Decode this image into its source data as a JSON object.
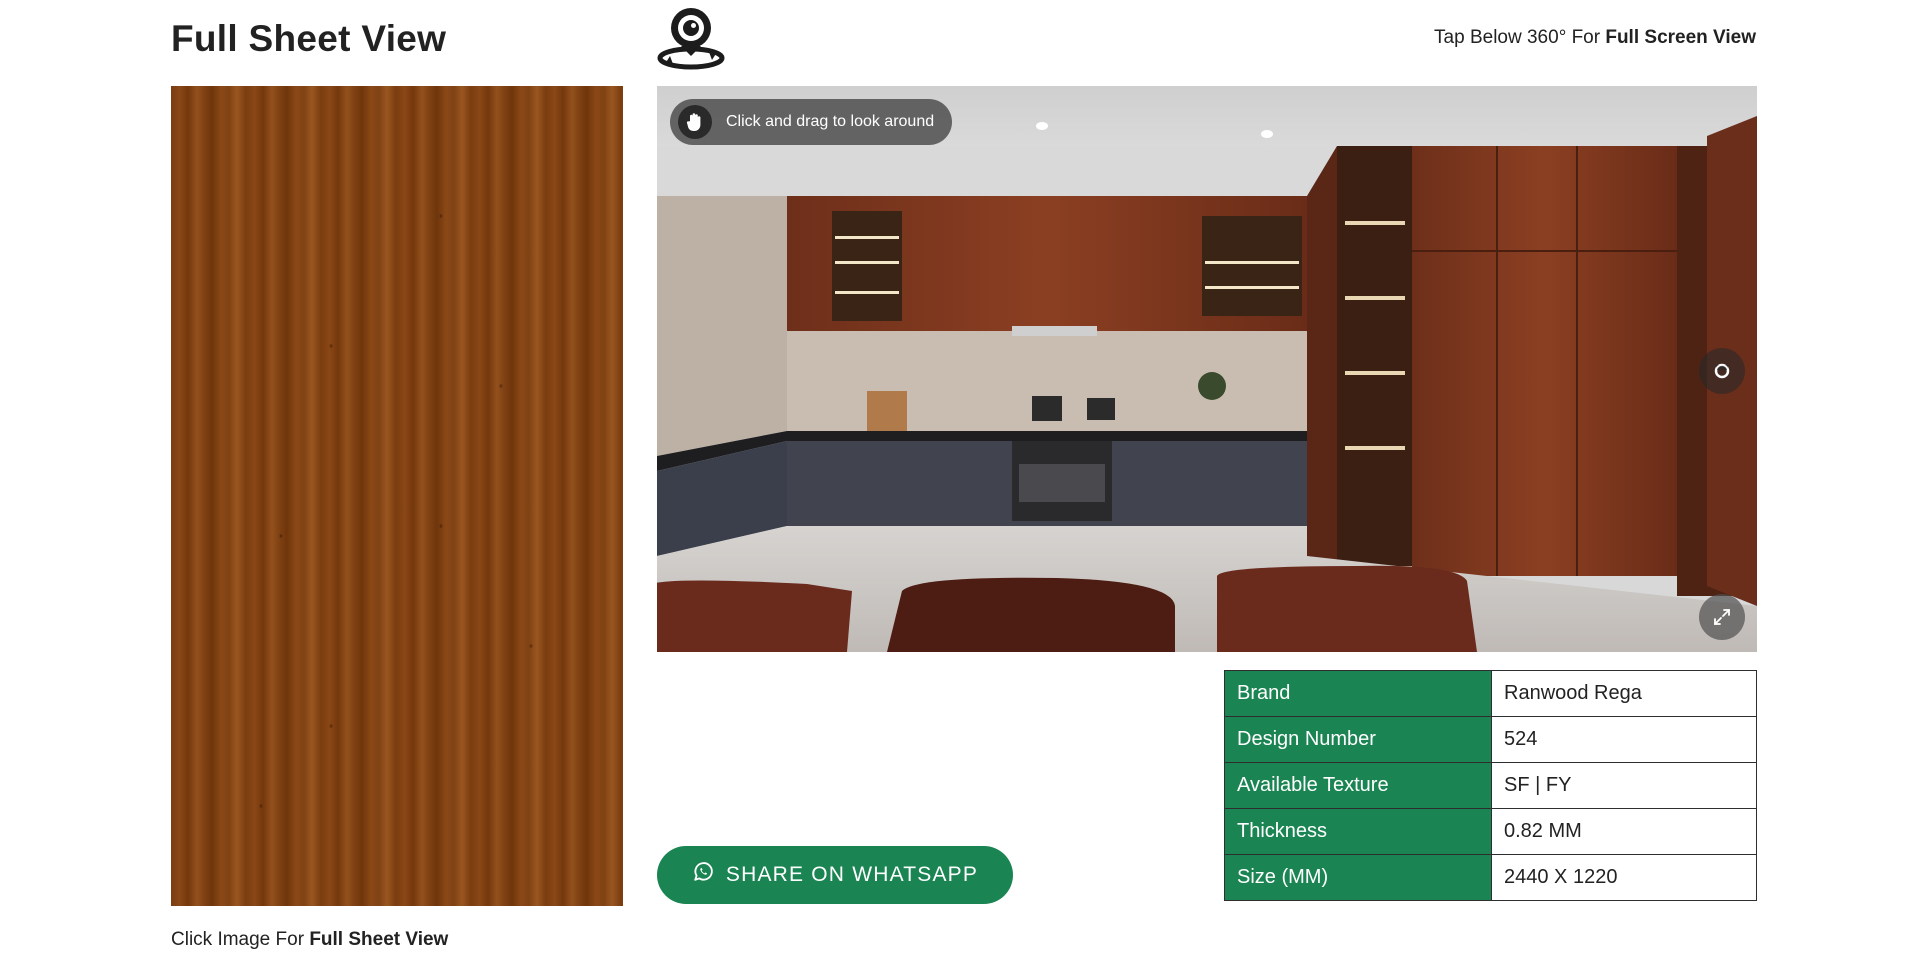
{
  "left": {
    "title": "Full Sheet View",
    "caption_prefix": "Click Image For ",
    "caption_bold": "Full Sheet View"
  },
  "header": {
    "tap_prefix": "Tap Below 360° For ",
    "tap_bold": "Full Screen View",
    "icon": "360-view-icon"
  },
  "viewer": {
    "drag_hint": "Click and drag to look around",
    "icons": [
      "hand-icon",
      "hotspot-icon",
      "fullscreen-icon"
    ]
  },
  "share": {
    "label": "SHARE ON WHATSAPP",
    "icon": "whatsapp-icon"
  },
  "specs": [
    {
      "key": "Brand",
      "value": "Ranwood Rega"
    },
    {
      "key": "Design Number",
      "value": "524"
    },
    {
      "key": "Available Texture",
      "value": "SF | FY"
    },
    {
      "key": "Thickness",
      "value": "0.82 MM"
    },
    {
      "key": "Size (MM)",
      "value": "2440 X 1220"
    }
  ],
  "colors": {
    "accent_green": "#1a8553",
    "laminate_brown": "#7a3d10",
    "text": "#222222"
  }
}
